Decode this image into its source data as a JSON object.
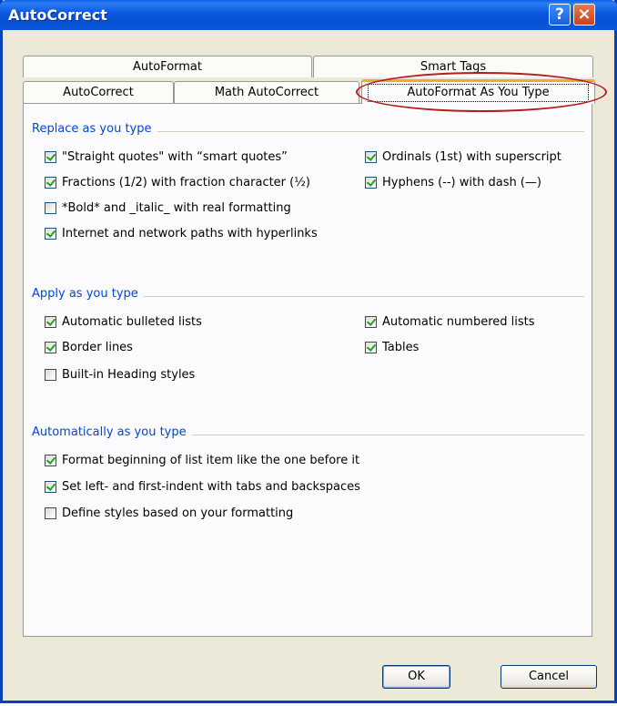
{
  "window": {
    "title": "AutoCorrect",
    "help_label": "?",
    "close_label": "×"
  },
  "tabs": {
    "row1": [
      "AutoFormat",
      "Smart Tags"
    ],
    "row2": [
      "AutoCorrect",
      "Math AutoCorrect",
      "AutoFormat As You Type"
    ],
    "active": "AutoFormat As You Type"
  },
  "groups": {
    "replace": {
      "label": "Replace as you type",
      "items": [
        {
          "label": "\"Straight quotes\" with “smart quotes”",
          "checked": true
        },
        {
          "label": "Fractions (1/2) with fraction character (½)",
          "checked": true
        },
        {
          "label": "*Bold* and _italic_ with real formatting",
          "checked": false
        },
        {
          "label": "Internet and network paths with hyperlinks",
          "checked": true
        },
        {
          "label": "Ordinals (1st) with superscript",
          "checked": true
        },
        {
          "label": "Hyphens (--) with dash (—)",
          "checked": true
        }
      ]
    },
    "apply": {
      "label": "Apply as you type",
      "items": [
        {
          "label": "Automatic bulleted lists",
          "checked": true
        },
        {
          "label": "Border lines",
          "checked": true
        },
        {
          "label": "Built-in Heading styles",
          "checked": false
        },
        {
          "label": "Automatic numbered lists",
          "checked": true
        },
        {
          "label": "Tables",
          "checked": true
        }
      ]
    },
    "auto": {
      "label": "Automatically as you type",
      "items": [
        {
          "label": "Format beginning of list item like the one before it",
          "checked": true
        },
        {
          "label": "Set left- and first-indent with tabs and backspaces",
          "checked": true
        },
        {
          "label": "Define styles based on your formatting",
          "checked": false
        }
      ]
    }
  },
  "buttons": {
    "ok": "OK",
    "cancel": "Cancel"
  },
  "colors": {
    "titlebar": "#0a58de",
    "group_label": "#0046d5",
    "highlight": "#b51c1c",
    "check": "#21a121"
  }
}
